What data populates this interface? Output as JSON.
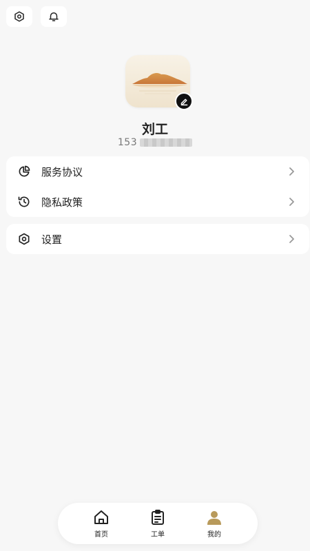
{
  "profile": {
    "name": "刘工",
    "phone_visible": "15",
    "phone_masked_hint": "3"
  },
  "menu_group_1": [
    {
      "label": "服务协议",
      "icon": "pie-chart-icon"
    },
    {
      "label": "隐私政策",
      "icon": "history-icon"
    }
  ],
  "menu_group_2": [
    {
      "label": "设置",
      "icon": "settings-hexagon-icon"
    }
  ],
  "tabbar": {
    "items": [
      {
        "label": "首页",
        "icon": "home-icon",
        "active": false
      },
      {
        "label": "工单",
        "icon": "clipboard-icon",
        "active": false
      },
      {
        "label": "我的",
        "icon": "user-icon",
        "active": true
      }
    ]
  },
  "colors": {
    "background": "#f7f7f7",
    "card": "#ffffff",
    "active_tab": "#b89a5b",
    "text": "#222222"
  }
}
